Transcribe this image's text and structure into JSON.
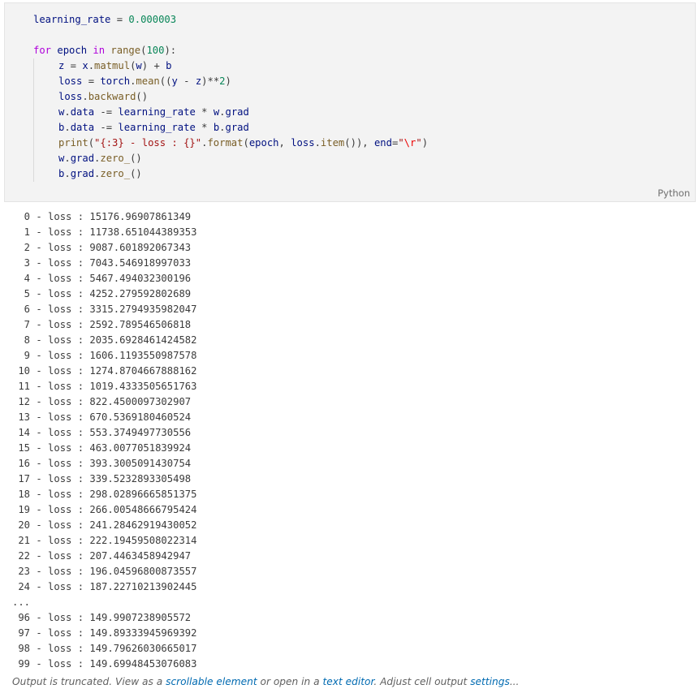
{
  "code_cell": {
    "language": "Python",
    "lines": [
      {
        "indent": 0,
        "tokens": [
          {
            "t": "learning_rate",
            "c": "var"
          },
          {
            "t": " = ",
            "c": "op"
          },
          {
            "t": "0.000003",
            "c": "num"
          }
        ]
      },
      {
        "indent": 0,
        "tokens": []
      },
      {
        "indent": 0,
        "tokens": [
          {
            "t": "for",
            "c": "kw"
          },
          {
            "t": " ",
            "c": "op"
          },
          {
            "t": "epoch",
            "c": "var"
          },
          {
            "t": " ",
            "c": "op"
          },
          {
            "t": "in",
            "c": "kw"
          },
          {
            "t": " ",
            "c": "op"
          },
          {
            "t": "range",
            "c": "fn"
          },
          {
            "t": "(",
            "c": "op"
          },
          {
            "t": "100",
            "c": "num"
          },
          {
            "t": "):",
            "c": "op"
          }
        ]
      },
      {
        "indent": 1,
        "tokens": [
          {
            "t": "z",
            "c": "var"
          },
          {
            "t": " = ",
            "c": "op"
          },
          {
            "t": "x",
            "c": "var"
          },
          {
            "t": ".",
            "c": "op"
          },
          {
            "t": "matmul",
            "c": "fn"
          },
          {
            "t": "(",
            "c": "op"
          },
          {
            "t": "w",
            "c": "var"
          },
          {
            "t": ") + ",
            "c": "op"
          },
          {
            "t": "b",
            "c": "var"
          }
        ]
      },
      {
        "indent": 1,
        "tokens": [
          {
            "t": "loss",
            "c": "var"
          },
          {
            "t": " = ",
            "c": "op"
          },
          {
            "t": "torch",
            "c": "var"
          },
          {
            "t": ".",
            "c": "op"
          },
          {
            "t": "mean",
            "c": "fn"
          },
          {
            "t": "((",
            "c": "op"
          },
          {
            "t": "y",
            "c": "var"
          },
          {
            "t": " - ",
            "c": "op"
          },
          {
            "t": "z",
            "c": "var"
          },
          {
            "t": ")**",
            "c": "op"
          },
          {
            "t": "2",
            "c": "num"
          },
          {
            "t": ")",
            "c": "op"
          }
        ]
      },
      {
        "indent": 1,
        "tokens": [
          {
            "t": "loss",
            "c": "var"
          },
          {
            "t": ".",
            "c": "op"
          },
          {
            "t": "backward",
            "c": "fn"
          },
          {
            "t": "()",
            "c": "op"
          }
        ]
      },
      {
        "indent": 1,
        "tokens": [
          {
            "t": "w",
            "c": "var"
          },
          {
            "t": ".",
            "c": "op"
          },
          {
            "t": "data",
            "c": "var"
          },
          {
            "t": " -= ",
            "c": "op"
          },
          {
            "t": "learning_rate",
            "c": "var"
          },
          {
            "t": " * ",
            "c": "op"
          },
          {
            "t": "w",
            "c": "var"
          },
          {
            "t": ".",
            "c": "op"
          },
          {
            "t": "grad",
            "c": "var"
          }
        ]
      },
      {
        "indent": 1,
        "tokens": [
          {
            "t": "b",
            "c": "var"
          },
          {
            "t": ".",
            "c": "op"
          },
          {
            "t": "data",
            "c": "var"
          },
          {
            "t": " -= ",
            "c": "op"
          },
          {
            "t": "learning_rate",
            "c": "var"
          },
          {
            "t": " * ",
            "c": "op"
          },
          {
            "t": "b",
            "c": "var"
          },
          {
            "t": ".",
            "c": "op"
          },
          {
            "t": "grad",
            "c": "var"
          }
        ]
      },
      {
        "indent": 1,
        "tokens": [
          {
            "t": "print",
            "c": "fn"
          },
          {
            "t": "(",
            "c": "op"
          },
          {
            "t": "\"{:3} - loss : {}\"",
            "c": "str"
          },
          {
            "t": ".",
            "c": "op"
          },
          {
            "t": "format",
            "c": "fn"
          },
          {
            "t": "(",
            "c": "op"
          },
          {
            "t": "epoch",
            "c": "var"
          },
          {
            "t": ", ",
            "c": "op"
          },
          {
            "t": "loss",
            "c": "var"
          },
          {
            "t": ".",
            "c": "op"
          },
          {
            "t": "item",
            "c": "fn"
          },
          {
            "t": "()), ",
            "c": "op"
          },
          {
            "t": "end",
            "c": "var"
          },
          {
            "t": "=",
            "c": "op"
          },
          {
            "t": "\"",
            "c": "str"
          },
          {
            "t": "\\r",
            "c": "esc"
          },
          {
            "t": "\"",
            "c": "str"
          },
          {
            "t": ")",
            "c": "op"
          }
        ]
      },
      {
        "indent": 1,
        "tokens": [
          {
            "t": "w",
            "c": "var"
          },
          {
            "t": ".",
            "c": "op"
          },
          {
            "t": "grad",
            "c": "var"
          },
          {
            "t": ".",
            "c": "op"
          },
          {
            "t": "zero_",
            "c": "fn"
          },
          {
            "t": "()",
            "c": "op"
          }
        ]
      },
      {
        "indent": 1,
        "tokens": [
          {
            "t": "b",
            "c": "var"
          },
          {
            "t": ".",
            "c": "op"
          },
          {
            "t": "grad",
            "c": "var"
          },
          {
            "t": ".",
            "c": "op"
          },
          {
            "t": "zero_",
            "c": "fn"
          },
          {
            "t": "()",
            "c": "op"
          }
        ]
      }
    ]
  },
  "output": {
    "lines": [
      "  0 - loss : 15176.96907861349",
      "  1 - loss : 11738.651044389353",
      "  2 - loss : 9087.601892067343",
      "  3 - loss : 7043.546918997033",
      "  4 - loss : 5467.494032300196",
      "  5 - loss : 4252.279592802689",
      "  6 - loss : 3315.2794935982047",
      "  7 - loss : 2592.789546506818",
      "  8 - loss : 2035.6928461424582",
      "  9 - loss : 1606.1193550987578",
      " 10 - loss : 1274.8704667888162",
      " 11 - loss : 1019.4333505651763",
      " 12 - loss : 822.4500097302907",
      " 13 - loss : 670.5369180460524",
      " 14 - loss : 553.3749497730556",
      " 15 - loss : 463.0077051839924",
      " 16 - loss : 393.3005091430754",
      " 17 - loss : 339.5232893305498",
      " 18 - loss : 298.02896665851375",
      " 19 - loss : 266.00548666795424",
      " 20 - loss : 241.28462919430052",
      " 21 - loss : 222.19459508022314",
      " 22 - loss : 207.4463458942947",
      " 23 - loss : 196.04596800873557",
      " 24 - loss : 187.22710213902445",
      "...",
      " 96 - loss : 149.9907238905572",
      " 97 - loss : 149.89333945969392",
      " 98 - loss : 149.79626030665017",
      " 99 - loss : 149.69948453076083"
    ]
  },
  "footer": {
    "prefix": "Output is truncated. View as a ",
    "link_scrollable": "scrollable element",
    "middle": " or open in a ",
    "link_editor": "text editor",
    "middle2": ". Adjust cell output ",
    "link_settings": "settings",
    "suffix": "..."
  },
  "colors": {
    "keyword": "#af00db",
    "function": "#795e26",
    "number": "#098658",
    "string": "#a31515",
    "escape": "#ee0000",
    "variable": "#001080",
    "link": "#006ab1"
  }
}
